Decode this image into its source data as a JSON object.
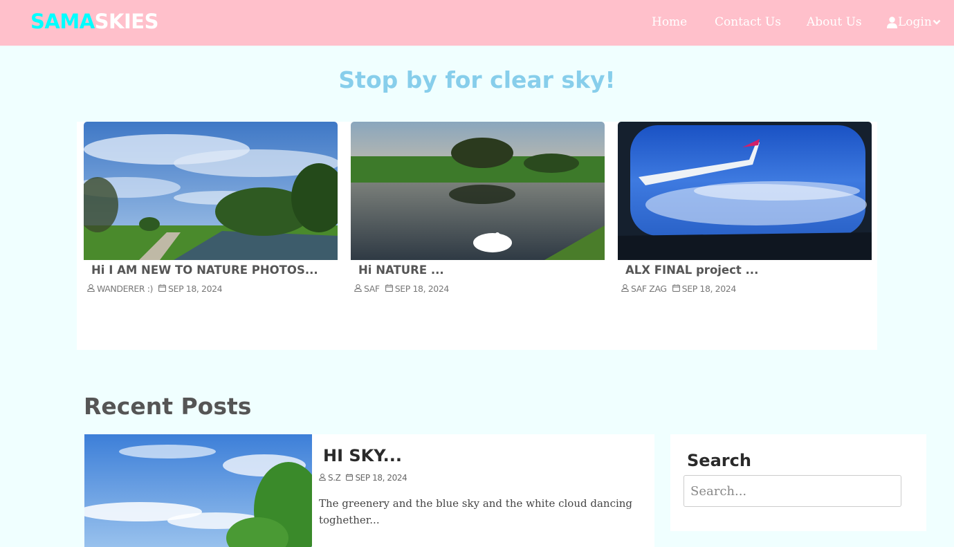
{
  "brand": {
    "part1": "SAMA",
    "part2": "SKIES"
  },
  "nav": {
    "home": "Home",
    "contact": "Contact Us",
    "about": "About Us",
    "login": "Login"
  },
  "hero": {
    "title": "Stop by for clear sky!"
  },
  "featured": [
    {
      "title": "Hi I AM NEW TO NATURE PHOTOS...",
      "author": "WANDERER :)",
      "date": "SEP 18, 2024"
    },
    {
      "title": "Hi NATURE ...",
      "author": "SAF",
      "date": "SEP 18, 2024"
    },
    {
      "title": "ALX FINAL project ...",
      "author": "SAF ZAG",
      "date": "SEP 18, 2024"
    }
  ],
  "recent": {
    "heading": "Recent Posts",
    "post": {
      "title": "HI SKY...",
      "author": "S.Z",
      "date": "SEP 18, 2024",
      "excerpt": "The greenery and the blue sky and the white cloud dancing toghether..."
    }
  },
  "search": {
    "title": "Search",
    "placeholder": "Search..."
  },
  "icons": {
    "user": "user-icon",
    "calendar": "calendar-icon",
    "login_user": "user-solid-icon",
    "chevron": "chevron-down-icon"
  }
}
